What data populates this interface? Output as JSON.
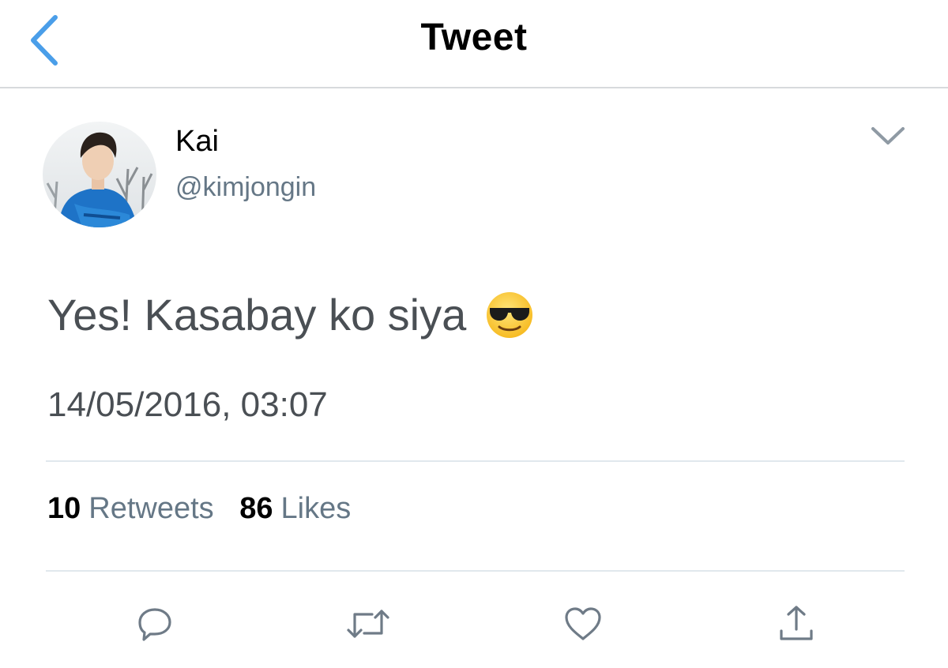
{
  "header": {
    "title": "Tweet",
    "back_icon": "chevron-left-icon"
  },
  "author": {
    "display_name": "Kai",
    "handle": "@kimjongin",
    "avatar": "profile-photo"
  },
  "tweet": {
    "text": "Yes! Kasabay ko siya",
    "emoji": "smiling-face-with-sunglasses",
    "timestamp": "14/05/2016, 03:07"
  },
  "stats": {
    "retweets_count": "10",
    "retweets_label": "Retweets",
    "likes_count": "86",
    "likes_label": "Likes"
  },
  "actions": [
    "reply-icon",
    "retweet-icon",
    "like-icon",
    "share-icon"
  ],
  "colors": {
    "accent": "#4a9ee9",
    "icon": "#6f7b87",
    "secondary_text": "#657786",
    "divider": "#e1e8ed"
  }
}
